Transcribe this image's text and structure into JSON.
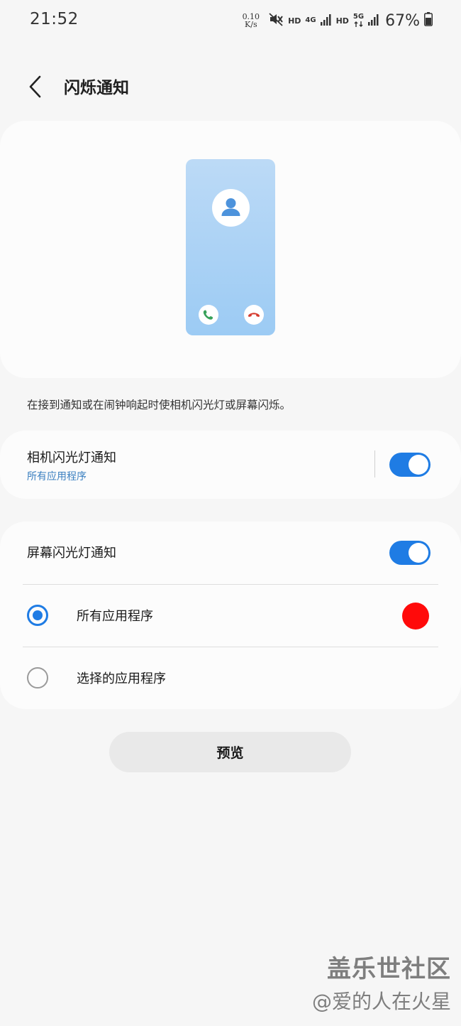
{
  "status_bar": {
    "time": "21:52",
    "net_speed_value": "0.10",
    "net_speed_unit": "K/s",
    "hd_label_1": "HD",
    "network_4g": "4G",
    "hd_label_2": "HD",
    "network_5g": "5G",
    "battery": "67%"
  },
  "header": {
    "title": "闪烁通知"
  },
  "description": "在接到通知或在闹钟响起时使相机闪光灯或屏幕闪烁。",
  "camera_flash": {
    "title": "相机闪光灯通知",
    "subtitle": "所有应用程序",
    "enabled": true
  },
  "screen_flash": {
    "title": "屏幕闪光灯通知",
    "enabled": true,
    "options": [
      {
        "label": "所有应用程序",
        "selected": true
      },
      {
        "label": "选择的应用程序",
        "selected": false
      }
    ],
    "selected_color": "#ff0a0a"
  },
  "preview_button": "预览",
  "watermark": {
    "line1": "盖乐世社区",
    "line2": "@爱的人在火星"
  },
  "colors": {
    "accent": "#1f7ce4",
    "subtitle": "#3a7fc0",
    "card": "#fcfcfc",
    "background": "#f6f6f6"
  }
}
